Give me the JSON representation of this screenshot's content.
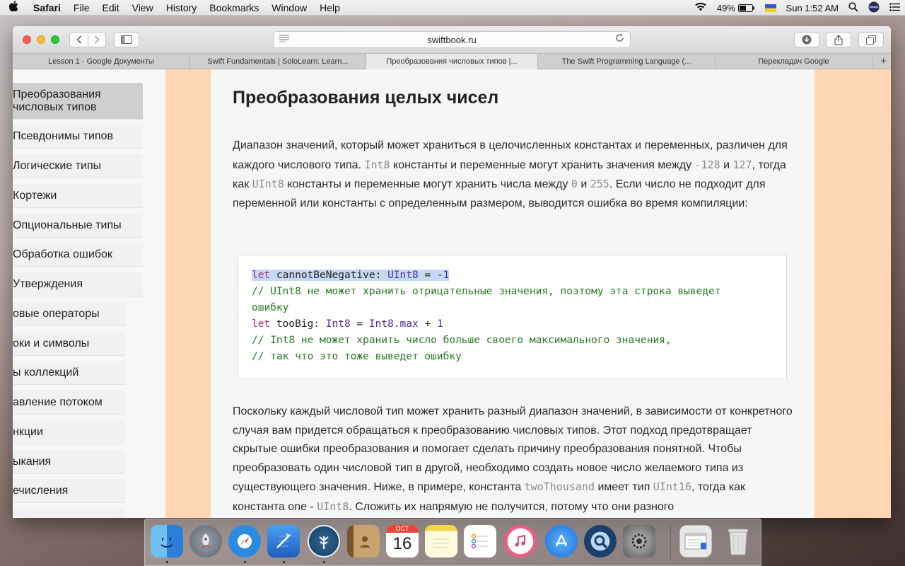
{
  "menubar": {
    "apple": "",
    "app": "Safari",
    "items": [
      "File",
      "Edit",
      "View",
      "History",
      "Bookmarks",
      "Window",
      "Help"
    ],
    "wifi_icon": "wifi-icon",
    "battery": "49%",
    "clock": "Sun 1:52 AM"
  },
  "browser": {
    "url": "swiftbook.ru",
    "tabs": [
      {
        "label": "Lesson 1 - Google Документы",
        "active": false
      },
      {
        "label": "Swift Fundamentals | SoloLearn: Learn...",
        "active": false
      },
      {
        "label": "Преобразования числовых типов |...",
        "active": true
      },
      {
        "label": "The Swift Programming Language (...",
        "active": false
      },
      {
        "label": "Перекладач Google",
        "active": false
      }
    ],
    "new_tab": "+"
  },
  "sidebar": {
    "items": [
      {
        "label": "Преобразования числовых типов",
        "line1": "Преобразования",
        "line2": "числовых типов",
        "selected": true
      },
      {
        "label": "Псевдонимы типов"
      },
      {
        "label": "Логические типы"
      },
      {
        "label": "Кортежи"
      },
      {
        "label": "Опциональные типы"
      },
      {
        "label": "Обработка ошибок"
      },
      {
        "label": "Утверждения"
      },
      {
        "label": "овые операторы"
      },
      {
        "label": "оки и символы"
      },
      {
        "label": "ы коллекций"
      },
      {
        "label": "авление потоком"
      },
      {
        "label": "нкции"
      },
      {
        "label": "ыкания"
      },
      {
        "label": "ечисления"
      }
    ]
  },
  "article": {
    "heading": "Преобразования целых чисел",
    "p1": {
      "t1": "Диапазон значений, который может храниться в целочисленных константах и переменных, различен для каждого числового типа. ",
      "c1": "Int8",
      "t2": " константы и переменные могут хранить значения между ",
      "c2": "-128",
      "t3": " и ",
      "c3": "127",
      "t4": ", тогда как ",
      "c4": "UInt8",
      "t5": " константы и переменные могут хранить числа между ",
      "c5": "0",
      "t6": " и ",
      "c6": "255",
      "t7": ". Если число не подходит для переменной или константы с определенным размером, выводится ошибка во время компиляции:"
    },
    "code": {
      "l1_kw": "let",
      "l1_name": " cannotBeNegative: ",
      "l1_type": "UInt8",
      "l1_eq": " = ",
      "l1_num": "-1",
      "l2": "// UInt8 не может хранить отрицательные значения, поэтому эта строка выведет",
      "l3": "ошибку",
      "l4_kw": "let",
      "l4_name": " tooBig: ",
      "l4_type": "Int8",
      "l4_eq": " = ",
      "l4_type2": "Int8",
      "l4_prop": ".max",
      "l4_plus": " + ",
      "l4_num": "1",
      "l5": "// Int8 не может хранить число больше своего максимального значения,",
      "l6": "// так что это тоже выведет ошибку"
    },
    "p2": {
      "t1": "Поскольку каждый числовой тип может хранить разный диапазон значений, в зависимости от конкретного случая вам придется обращаться к преобразованию числовых типов. Этот подход предотвращает скрытые ошибки преобразования и помогает сделать причину преобразования понятной. Чтобы преобразовать один числовой тип в другой, необходимо создать новое число желаемого типа из существующего значения. Ниже, в примере, константа ",
      "c1": "twoThousand",
      "t2": " имеет тип ",
      "c2": "UInt16",
      "t3": ", тогда как константа one - ",
      "c3": "UInt8",
      "t4": ". Сложить их напрямую не получится, потому что они разного"
    }
  },
  "dock": {
    "apps": [
      {
        "name": "finder-icon",
        "color": "#3a8ee6"
      },
      {
        "name": "launchpad-icon",
        "color": "#7d8590"
      },
      {
        "name": "safari-icon",
        "color": "#2b8be0"
      },
      {
        "name": "xcode-icon",
        "color": "#2f6fd6"
      },
      {
        "name": "sourcetree-icon",
        "color": "#1e4f7a"
      },
      {
        "name": "contacts-icon",
        "color": "#b08a5a"
      },
      {
        "name": "calendar-icon",
        "color": "#ffffff"
      },
      {
        "name": "notes-icon",
        "color": "#f7e27a"
      },
      {
        "name": "reminders-icon",
        "color": "#ffffff"
      },
      {
        "name": "itunes-icon",
        "color": "#f05a8a"
      },
      {
        "name": "app-store-icon",
        "color": "#2a8cf0"
      },
      {
        "name": "quicktime-icon",
        "color": "#1d3f6b"
      },
      {
        "name": "system-preferences-icon",
        "color": "#8a8a8a"
      }
    ],
    "calendar_month": "OCT",
    "calendar_day": "16"
  }
}
